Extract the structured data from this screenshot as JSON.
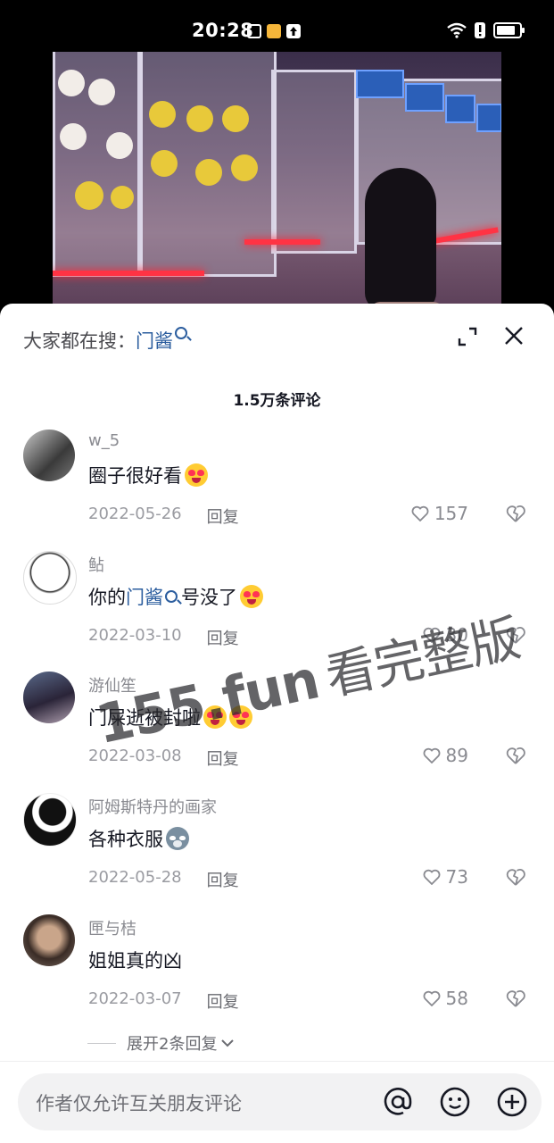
{
  "status_bar": {
    "time": "20:28"
  },
  "sheet": {
    "search_prefix": "大家都在搜：",
    "search_keyword": "门酱",
    "comment_count": "1.5万条评论"
  },
  "comments": [
    {
      "user": "w_5",
      "text": "圈子很好看",
      "date": "2022-05-26",
      "reply": "回复",
      "likes": "157"
    },
    {
      "user": "鲇",
      "text_before": "你的",
      "keyword": "门酱",
      "text_after": "号没了",
      "date": "2022-03-10",
      "reply": "回复",
      "likes": "30"
    },
    {
      "user": "游仙笙",
      "text": "门屎逝被封啦",
      "date": "2022-03-08",
      "reply": "回复",
      "likes": "89"
    },
    {
      "user": "阿姆斯特丹的画家",
      "text": "各种衣服",
      "date": "2022-05-28",
      "reply": "回复",
      "likes": "73"
    },
    {
      "user": "匣与桔",
      "text": "姐姐真的凶",
      "date": "2022-03-07",
      "reply": "回复",
      "likes": "58"
    }
  ],
  "expand_replies": "展开2条回复",
  "input": {
    "placeholder": "作者仅允许互关朋友评论"
  },
  "watermark": {
    "site": "155.fun",
    "text": "看完整版"
  },
  "colors": {
    "keyword": "#2b5d9e",
    "meta": "#9a9ba1",
    "text": "#161823"
  }
}
